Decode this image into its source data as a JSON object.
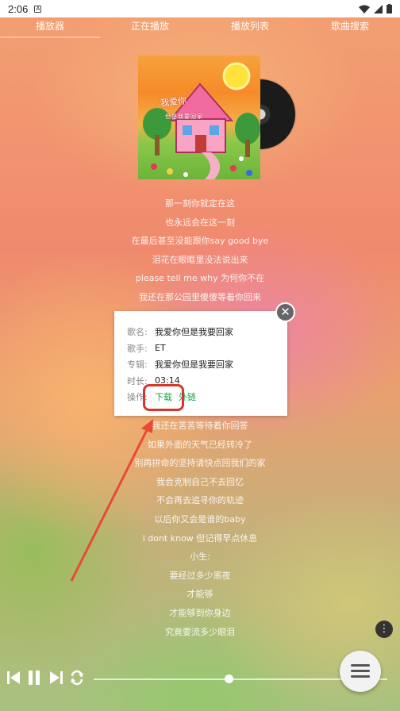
{
  "status_bar": {
    "time": "2:06",
    "sim_glyph": "A"
  },
  "tabs": [
    {
      "label": "播放器"
    },
    {
      "label": "正在播放"
    },
    {
      "label": "播放列表"
    },
    {
      "label": "歌曲搜索"
    }
  ],
  "album": {
    "cover_title": "我爱你",
    "cover_subtitle": "但是我要回家"
  },
  "lyrics_top": [
    "那一刻你就定在这",
    "也永远会在这一刻",
    "在最后甚至没能跟你say good bye",
    "泪花在眼眶里没法说出来",
    "please tell me why 为何你不在",
    "我还在那公园里傻傻等着你回来"
  ],
  "lyrics_bottom": [
    "我还在苦苦等待着你回答",
    "如果外面的天气已经转冷了",
    "别再拼命的坚持请快点回我们的家",
    "我会克制自己不去回忆",
    "不会再去追寻你的轨迹",
    "以后你又会是谁的baby",
    "i dont know 但记得早点休息",
    "小生:",
    "要经过多少黑夜",
    "才能够",
    "才能够到你身边",
    "究竟要流多少眼泪"
  ],
  "dialog": {
    "name_label": "歌名:",
    "name_value": "我爱你但是我要回家",
    "singer_label": "歌手:",
    "singer_value": "ET",
    "album_label": "专辑:",
    "album_value": "我爱你但是我要回家",
    "duration_label": "时长:",
    "duration_value": "03:14",
    "action_label": "操作:",
    "download_link": "下载",
    "outer_link": "外链",
    "close_glyph": "✕"
  },
  "player": {
    "progress_fraction": 0.46
  },
  "more_glyph": "⋮",
  "colors": {
    "accent_green": "#1aa34a",
    "highlight_red": "#d9352a"
  }
}
